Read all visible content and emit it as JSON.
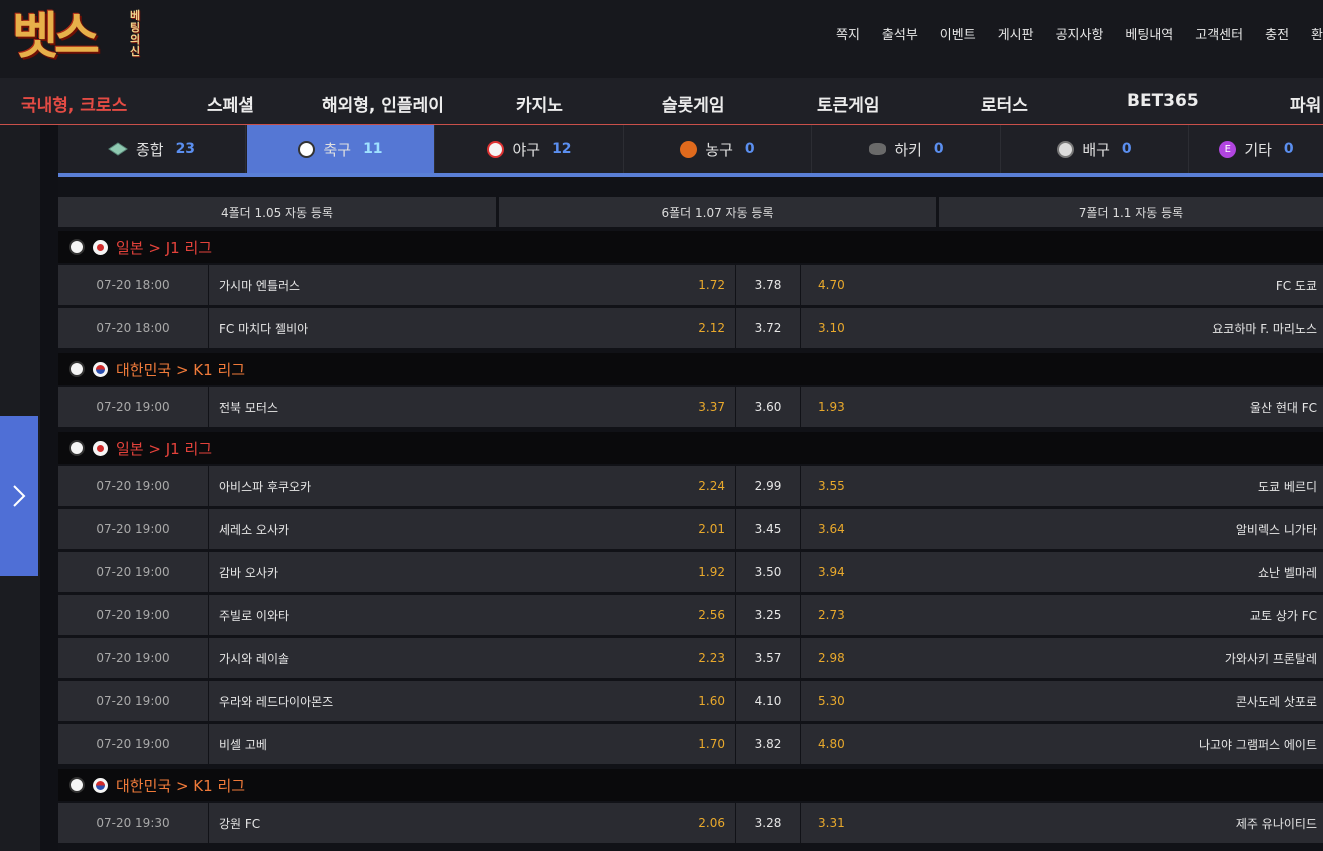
{
  "brand": {
    "logo_big": "벳스",
    "logo_small": "베팅의신"
  },
  "top_nav": [
    "쪽지",
    "출석부",
    "이벤트",
    "게시판",
    "공지사항",
    "베팅내역",
    "고객센터",
    "충전",
    "환"
  ],
  "main_nav": [
    "국내형, 크로스",
    "스페셜",
    "해외형, 인플레이",
    "카지노",
    "슬롯게임",
    "토큰게임",
    "로터스",
    "BET365",
    "파워"
  ],
  "sport_tabs": [
    {
      "label": "종합",
      "count": "23"
    },
    {
      "label": "축구",
      "count": "11"
    },
    {
      "label": "야구",
      "count": "12"
    },
    {
      "label": "농구",
      "count": "0"
    },
    {
      "label": "하키",
      "count": "0"
    },
    {
      "label": "배구",
      "count": "0"
    },
    {
      "label": "기타",
      "count": "0"
    }
  ],
  "bonus": [
    "4폴더 1.05 자동 등록",
    "6폴더 1.07 자동 등록",
    "7폴더 1.1 자동 등록"
  ],
  "leagues": [
    {
      "name": "일본 > J1 리그"
    },
    {
      "name": "대한민국 > K1 리그"
    },
    {
      "name": "일본 > J1 리그"
    },
    {
      "name": "대한민국 > K1 리그"
    }
  ],
  "games": [
    {
      "time": "07-20 18:00",
      "home": "가시마 엔틀러스",
      "home_odds": "1.72",
      "draw": "3.78",
      "away_odds": "4.70",
      "away": "FC 도쿄"
    },
    {
      "time": "07-20 18:00",
      "home": "FC 마치다 젤비아",
      "home_odds": "2.12",
      "draw": "3.72",
      "away_odds": "3.10",
      "away": "요코하마 F. 마리노스"
    },
    {
      "time": "07-20 19:00",
      "home": "전북 모터스",
      "home_odds": "3.37",
      "draw": "3.60",
      "away_odds": "1.93",
      "away": "울산 현대 FC"
    },
    {
      "time": "07-20 19:00",
      "home": "아비스파 후쿠오카",
      "home_odds": "2.24",
      "draw": "2.99",
      "away_odds": "3.55",
      "away": "도쿄 베르디"
    },
    {
      "time": "07-20 19:00",
      "home": "세레소 오사카",
      "home_odds": "2.01",
      "draw": "3.45",
      "away_odds": "3.64",
      "away": "알비렉스 니가타"
    },
    {
      "time": "07-20 19:00",
      "home": "감바 오사카",
      "home_odds": "1.92",
      "draw": "3.50",
      "away_odds": "3.94",
      "away": "쇼난 벨마레"
    },
    {
      "time": "07-20 19:00",
      "home": "주빌로 이와타",
      "home_odds": "2.56",
      "draw": "3.25",
      "away_odds": "2.73",
      "away": "교토 상가 FC"
    },
    {
      "time": "07-20 19:00",
      "home": "가시와 레이솔",
      "home_odds": "2.23",
      "draw": "3.57",
      "away_odds": "2.98",
      "away": "가와사키 프론탈레"
    },
    {
      "time": "07-20 19:00",
      "home": "우라와 레드다이아몬즈",
      "home_odds": "1.60",
      "draw": "4.10",
      "away_odds": "5.30",
      "away": "콘사도레 삿포로"
    },
    {
      "time": "07-20 19:00",
      "home": "비셀 고베",
      "home_odds": "1.70",
      "draw": "3.82",
      "away_odds": "4.80",
      "away": "나고야 그램퍼스 에이트"
    },
    {
      "time": "07-20 19:30",
      "home": "강원 FC",
      "home_odds": "2.06",
      "draw": "3.28",
      "away_odds": "3.31",
      "away": "제주 유나이티드"
    }
  ]
}
